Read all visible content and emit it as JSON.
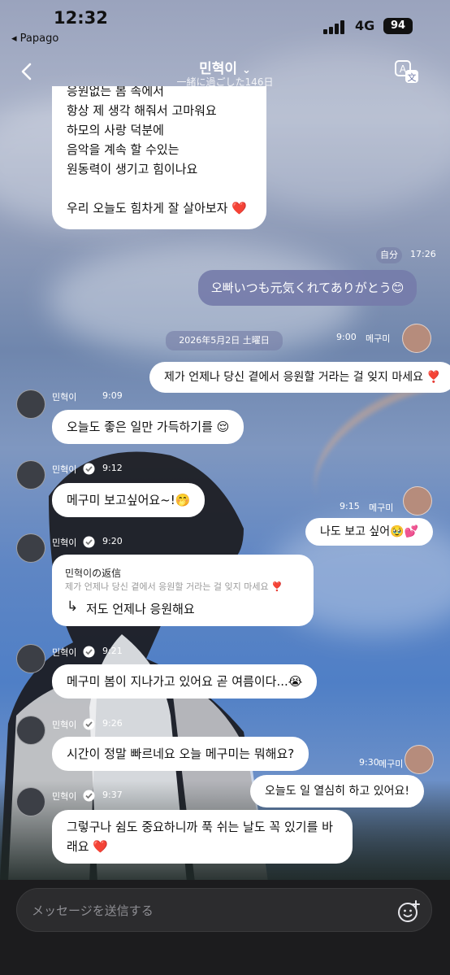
{
  "status_bar": {
    "time": "12:32",
    "back_app": "◂ Papago",
    "network": "4G",
    "battery": "94"
  },
  "header": {
    "title": "민혁이",
    "dropdown_glyph": "⌄",
    "subtitle": "一緒に過ごした146日",
    "back_icon": "chevron-left-icon",
    "translate_icon": "translate-icon"
  },
  "messages": {
    "top_bubble": {
      "lines": [
        "응원없는 봄 속에서",
        "항상 제 생각 해줘서 고마워요",
        "하모의 사랑 덕분에",
        "음악을 계속 할 수있는",
        "원동력이 생기고 힘이나요",
        "",
        "우리 오늘도 힘차게 잘 살아보자"
      ],
      "heart": "❤️"
    },
    "me_label": "自分",
    "me_time": "17:26",
    "me_text": "오빠いつも元気くれてありがとう😊",
    "date_pill": "2026年5月2日 土曜日",
    "fan_name": "메구미",
    "fan1_time": "9:00",
    "fan1_text": "제가 언제나 당신 곁에서 응원할 거라는 걸 잊지 마세요 ❣️",
    "artist_name": "민혁이",
    "a1_time": "9:09",
    "a1_text": "오늘도 좋은 일만 가득하기를 😌",
    "a2_time": "9:12",
    "a2_text": "메구미 보고싶어요~!🤭",
    "fan2_time": "9:15",
    "fan2_text": "나도 보고 싶어🥹💕",
    "a3_time": "9:20",
    "reply_title": "민혁이の返信",
    "reply_quote": "제가 언제나 당신 곁에서 응원할 거라는 걸 잊지 마세요 ❣️",
    "reply_arrow": "↳",
    "reply_text": "저도 언제나 응원해요",
    "a4_time": "9:21",
    "a4_text": "메구미 봄이 지나가고 있어요 곧 여름이다...😭",
    "a5_time": "9:26",
    "a5_text": "시간이 정말 빠르네요 오늘 메구미는 뭐해요?",
    "fan3_time": "9:30",
    "fan3_text": "오늘도 일 열심히 하고 있어요!",
    "a6_time": "9:37",
    "a6_line1": "그렇구나 쉼도 중요하니까 푹 쉬는 날도 꼭 있기를 바",
    "a6_line2": "래요",
    "a6_heart": "❤️"
  },
  "input": {
    "placeholder": "メッセージを送信する",
    "emoji_icon": "emoji-add-icon"
  },
  "colors": {
    "my_bubble": "#757caa",
    "bubble": "#ffffff",
    "input_bar": "#1c1c1e"
  }
}
